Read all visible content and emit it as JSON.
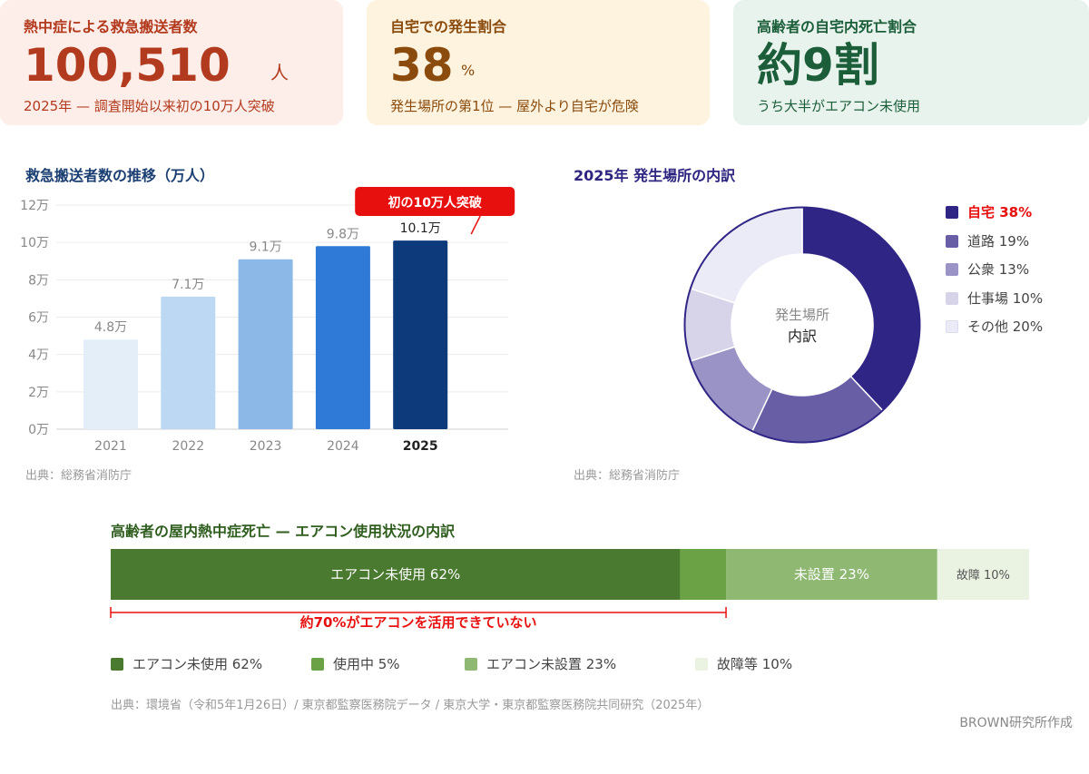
{
  "kpis": [
    {
      "label": "熱中症による救急搬送者数",
      "value": "100,510",
      "unit": "人",
      "sub": "2025年 — 調査開始以来初の10万人突破"
    },
    {
      "label": "自宅での発生割合",
      "value": "38",
      "unit": "%",
      "sub": "発生場所の第1位 — 屋外より自宅が危険"
    },
    {
      "label": "高齢者の自宅内死亡割合",
      "value": "約9割",
      "sub": "うち大半がエアコン未使用"
    }
  ],
  "bar_section": {
    "title": "救急搬送者数の推移（万人）",
    "source": "出典：総務省消防庁"
  },
  "pie_section": {
    "title": "2025年 発生場所の内訳",
    "source": "出典：総務省消防庁"
  },
  "stack_section": {
    "title": "高齢者の屋内熱中症死亡 — エアコン使用状況の内訳",
    "source": "出典：環境省（令和5年1月26日）/ 東京都監察医務院データ / 東京大学・東京都監察医務院共同研究（2025年）"
  },
  "credit": "BROWN研究所作成",
  "chart_data": [
    {
      "type": "bar",
      "title": "救急搬送者数の推移（万人）",
      "categories": [
        "2021",
        "2022",
        "2023",
        "2024",
        "2025"
      ],
      "values": [
        4.8,
        7.1,
        9.1,
        9.8,
        10.1
      ],
      "data_labels": [
        "4.8万",
        "7.1万",
        "9.1万",
        "9.8万",
        "10.1万"
      ],
      "ylim": [
        0,
        12
      ],
      "yticks": [
        0,
        2,
        4,
        6,
        8,
        10,
        12
      ],
      "ytick_labels": [
        "0万",
        "2万",
        "4万",
        "6万",
        "8万",
        "10万",
        "12万"
      ],
      "grid": true,
      "colors": [
        "#e3eef9",
        "#bcd8f3",
        "#8cb8e8",
        "#2e7ad6",
        "#0c3a7a"
      ],
      "annotation": {
        "text": "初の10万人突破",
        "target": "2025",
        "color": "#e8100f"
      }
    },
    {
      "type": "pie",
      "title": "2025年 発生場所の内訳",
      "donut": true,
      "center_label": [
        "発生場所",
        "内訳"
      ],
      "slices": [
        {
          "label": "自宅",
          "value": 38,
          "color": "#2e2585",
          "highlight": true
        },
        {
          "label": "道路",
          "value": 19,
          "color": "#675ea6"
        },
        {
          "label": "公衆",
          "value": 13,
          "color": "#9a93c6"
        },
        {
          "label": "仕事場",
          "value": 10,
          "color": "#d7d4ea"
        },
        {
          "label": "その他",
          "value": 20,
          "color": "#ebeaf7"
        }
      ],
      "legend_position": "right",
      "legend_labels": [
        "自宅 38%",
        "道路 19%",
        "公衆 13%",
        "仕事場 10%",
        "その他 20%"
      ],
      "highlight_color": "#e8100f"
    },
    {
      "type": "bar",
      "orientation": "horizontal-stacked",
      "title": "高齢者の屋内熱中症死亡 — エアコン使用状況の内訳",
      "segments": [
        {
          "label": "エアコン未使用",
          "value": 62,
          "color": "#4a7a2f",
          "bar_label": "エアコン未使用 62%"
        },
        {
          "label": "使用中",
          "value": 5,
          "color": "#6aa245",
          "bar_label": ""
        },
        {
          "label": "エアコン未設置",
          "value": 23,
          "color": "#8fb873",
          "bar_label": "未設置 23%"
        },
        {
          "label": "故障等",
          "value": 10,
          "color": "#eaf2e2",
          "bar_label": "故障 10%"
        }
      ],
      "legend_labels": [
        "エアコン未使用 62%",
        "使用中 5%",
        "エアコン未設置 23%",
        "故障等 10%"
      ],
      "bracket": {
        "text": "約70%がエアコンを活用できていない",
        "from": 0,
        "to": 67,
        "color": "#e8100f"
      }
    }
  ]
}
